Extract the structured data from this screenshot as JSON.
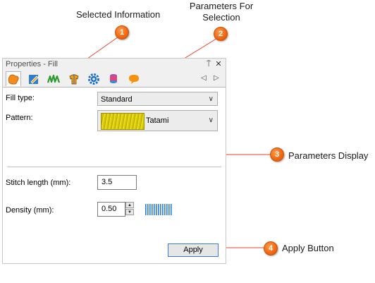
{
  "annotations": {
    "selected_information": "Selected Information",
    "parameters_for_selection_line1": "Parameters For",
    "parameters_for_selection_line2": "Selection",
    "parameters_display": "Parameters Display",
    "apply_button": "Apply Button",
    "badge_1": "1",
    "badge_2": "2",
    "badge_3": "3",
    "badge_4": "4",
    "badge_color": "#f26a12",
    "marker_color": "#e8402a"
  },
  "panel": {
    "title": "Properties - Fill",
    "pin_icon": "⍑",
    "close_icon": "✕",
    "tabs": [
      {
        "icon": "fill-shape-icon",
        "active": true
      },
      {
        "icon": "outline-edit-icon",
        "active": false
      },
      {
        "icon": "stitch-wave-icon",
        "active": false
      },
      {
        "icon": "fabric-thread-icon",
        "active": false
      },
      {
        "icon": "settings-gear-icon",
        "active": false
      },
      {
        "icon": "color-spool-icon",
        "active": false
      },
      {
        "icon": "speech-bubble-icon",
        "active": false
      }
    ],
    "nav_prev": "◁",
    "nav_next": "▷"
  },
  "form": {
    "fill_type_label": "Fill type:",
    "fill_type_value": "Standard",
    "pattern_label": "Pattern:",
    "pattern_value": "Tatami",
    "stitch_length_label": "Stitch length (mm):",
    "stitch_length_value": "3.5",
    "density_label": "Density (mm):",
    "density_value": "0.50",
    "apply_label": "Apply"
  }
}
